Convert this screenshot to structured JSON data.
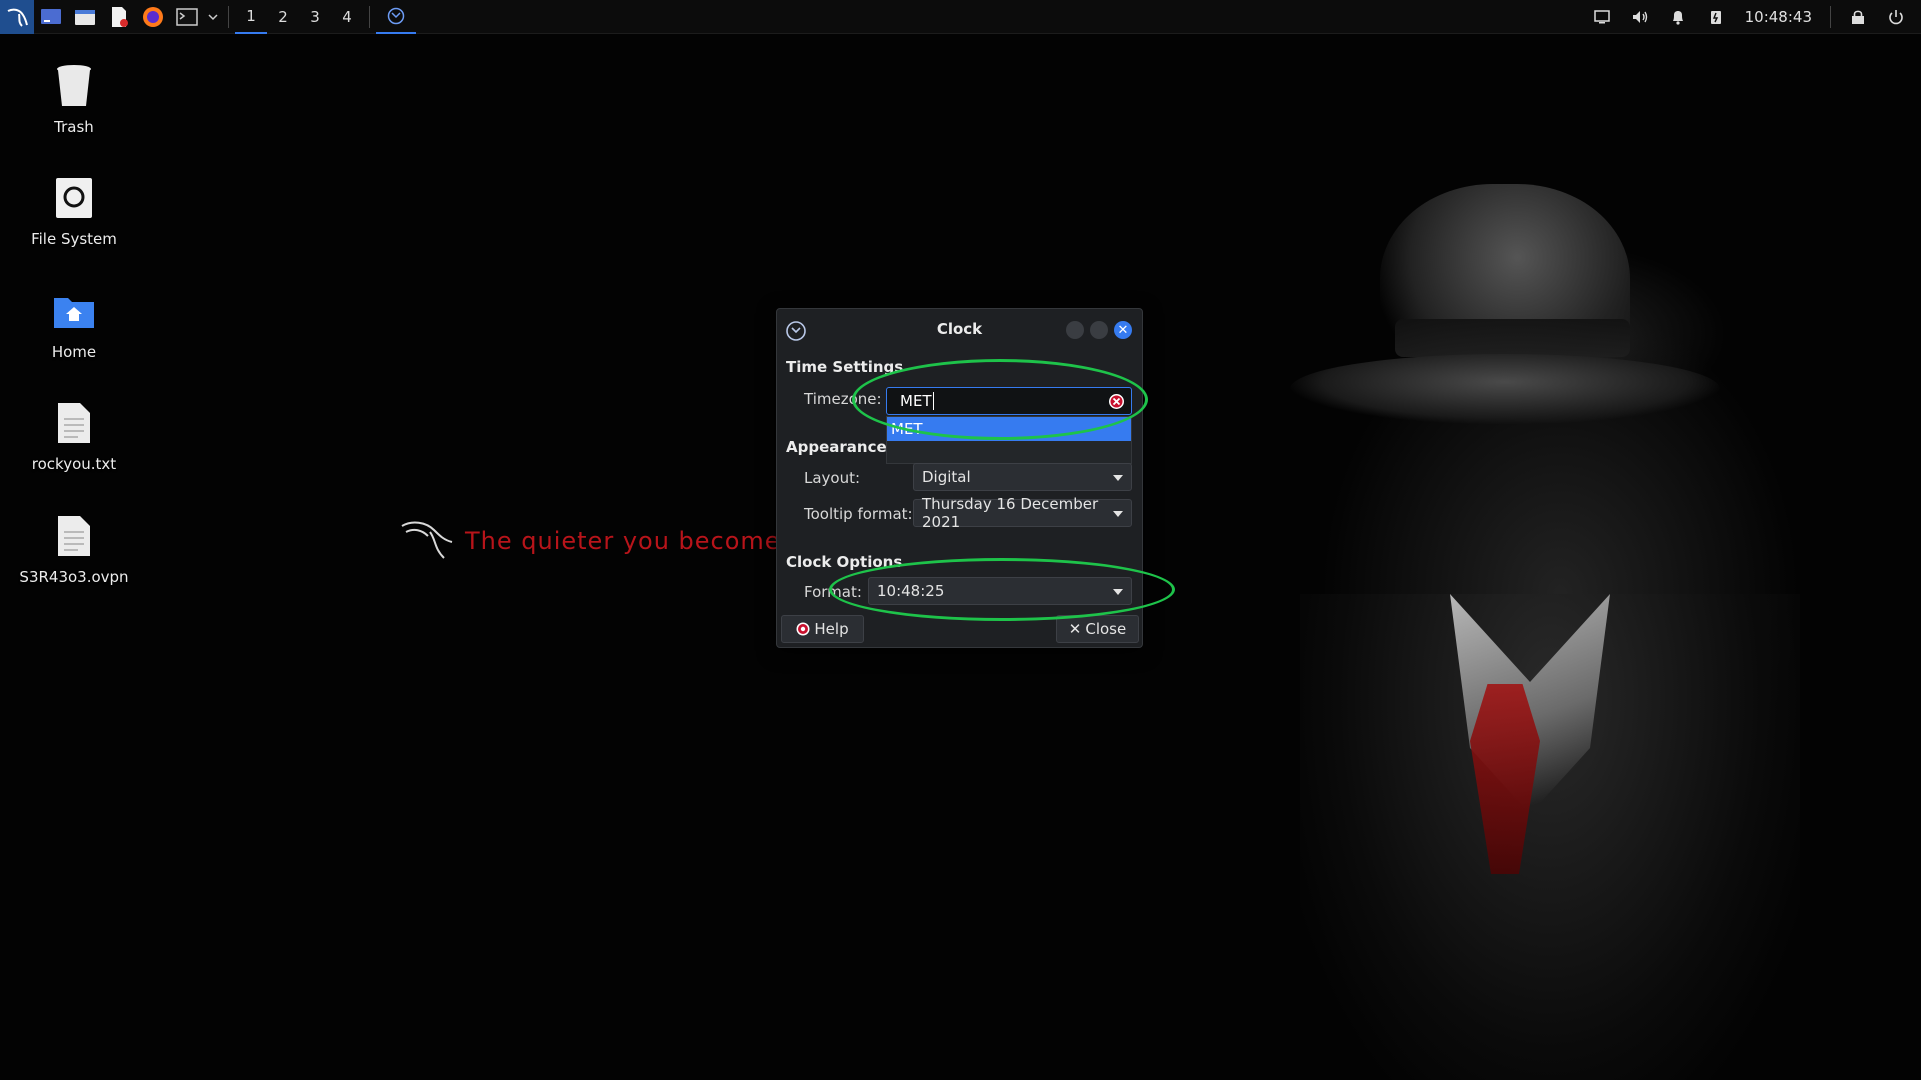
{
  "panel": {
    "workspaces": [
      "1",
      "2",
      "3",
      "4"
    ],
    "active_workspace": "1",
    "clock": "10:48:43",
    "accent": "#367bf0"
  },
  "desktop": {
    "icons": [
      {
        "label": "Trash",
        "icon": "trash-icon"
      },
      {
        "label": "File System",
        "icon": "drive-icon"
      },
      {
        "label": "Home",
        "icon": "home-folder-icon"
      },
      {
        "label": "rockyou.txt",
        "icon": "text-file-icon"
      },
      {
        "label": "S3R43o3.ovpn",
        "icon": "text-file-icon"
      }
    ],
    "slogan": "The quieter you become,"
  },
  "dialog": {
    "title": "Clock",
    "time_settings": {
      "heading": "Time Settings",
      "timezone_label": "Timezone:",
      "timezone_value": "MET",
      "suggestions": [
        "MET"
      ]
    },
    "appearance": {
      "heading": "Appearance",
      "layout_label": "Layout:",
      "layout_value": "Digital",
      "tooltip_label": "Tooltip format:",
      "tooltip_value": "Thursday 16 December 2021"
    },
    "clock_options": {
      "heading": "Clock Options",
      "format_label": "Format:",
      "format_value": "10:48:25"
    },
    "help_label": "Help",
    "close_label": "Close"
  },
  "annotation_color": "#1ec34a"
}
